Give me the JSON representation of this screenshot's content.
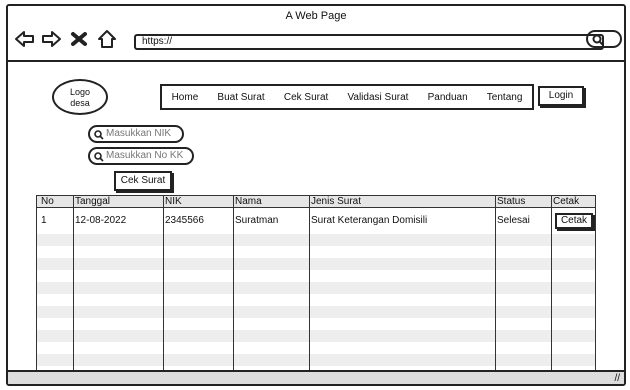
{
  "browser": {
    "title": "A Web Page",
    "url": "https://"
  },
  "header": {
    "logo_text": "Logo\ndesa",
    "menu": [
      "Home",
      "Buat Surat",
      "Cek Surat",
      "Validasi Surat",
      "Panduan",
      "Tentang"
    ],
    "login_label": "Login"
  },
  "form": {
    "nik_placeholder": "Masukkan NIK",
    "kk_placeholder": "Masukkan No KK",
    "submit_label": "Cek Surat"
  },
  "table": {
    "columns": [
      "No",
      "Tanggal",
      "NIK",
      "Nama",
      "Jenis Surat",
      "Status",
      "Cetak"
    ],
    "rows": [
      {
        "no": "1",
        "tanggal": "12-08-2022",
        "nik": "2345566",
        "nama": "Suratman",
        "jenis_surat": "Surat Keterangan Domisili",
        "status": "Selesai",
        "cetak": "Cetak"
      }
    ]
  },
  "icons": {
    "back": "left-arrow-icon",
    "forward": "right-arrow-icon",
    "stop": "close-icon",
    "home": "home-icon",
    "search": "search-icon",
    "resize": "resize-grip-icon"
  }
}
